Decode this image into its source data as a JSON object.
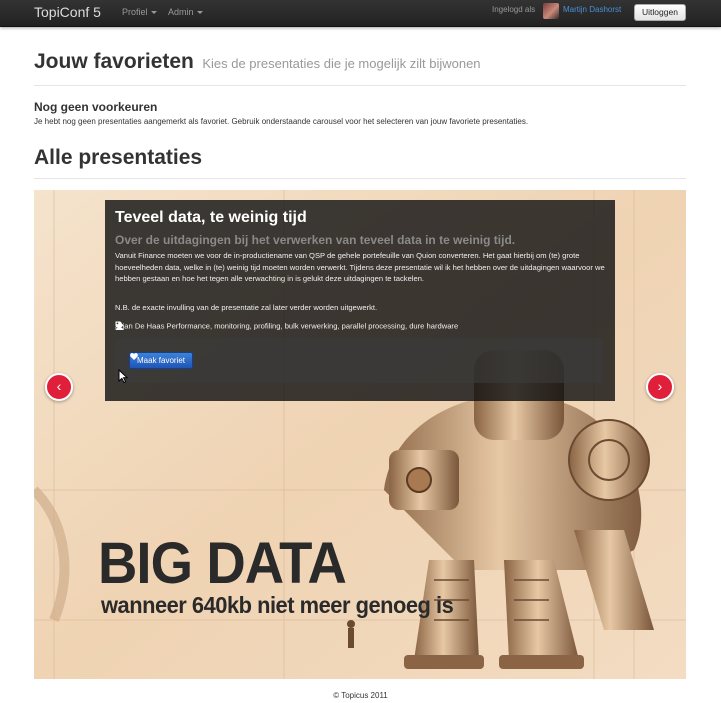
{
  "navbar": {
    "brand": "TopiConf 5",
    "menu": [
      {
        "label": "Profiel"
      },
      {
        "label": "Admin"
      }
    ],
    "login_prefix": "Ingelogd als",
    "user_name": "Martijn Dashorst",
    "logout_label": "Uitloggen"
  },
  "favorites": {
    "title": "Jouw favorieten",
    "subtitle": "Kies de presentaties die je mogelijk zilt bijwonen",
    "empty_heading": "Nog geen voorkeuren",
    "empty_text": "Je hebt nog geen presentaties aangemerkt als favoriet. Gebruik onderstaande carousel voor het selecteren van jouw favoriete presentaties."
  },
  "all": {
    "title": "Alle presentaties"
  },
  "carousel": {
    "title": "Teveel data, te weinig tijd",
    "subtitle": "Over de uitdagingen bij het verwerken van teveel data in te weinig tijd.",
    "description": "Vanuit Finance moeten we voor de in-productiename van QSP de gehele portefeuille van Quion converteren. Het gaat hierbij om (te) grote hoeveelheden data, welke in (te) weinig tijd moeten worden verwerkt. Tijdens deze presentatie wil ik het hebben over de uitdagingen waarvoor we hebben gestaan en hoe het tegen alle verwachting in is gelukt deze uitdagingen te tackelen.",
    "note": "N.B. de exacte invulling van de presentatie zal later verder worden uitgewerkt.",
    "speaker": "Arjan De Haas",
    "tags": "Performance, monitoring, profiling, bulk verwerking, parallel processing, dure hardware",
    "fav_button": "Maak favoriet",
    "prev": "‹",
    "next": "›",
    "image_title": "BIG DATA",
    "image_subtitle": "wanneer 640kb niet meer genoeg is",
    "icons": {
      "speaker": "user-icon",
      "tags": "tag-icon",
      "favorite": "heart-icon"
    }
  },
  "footer": {
    "text": "© Topicus 2011"
  }
}
